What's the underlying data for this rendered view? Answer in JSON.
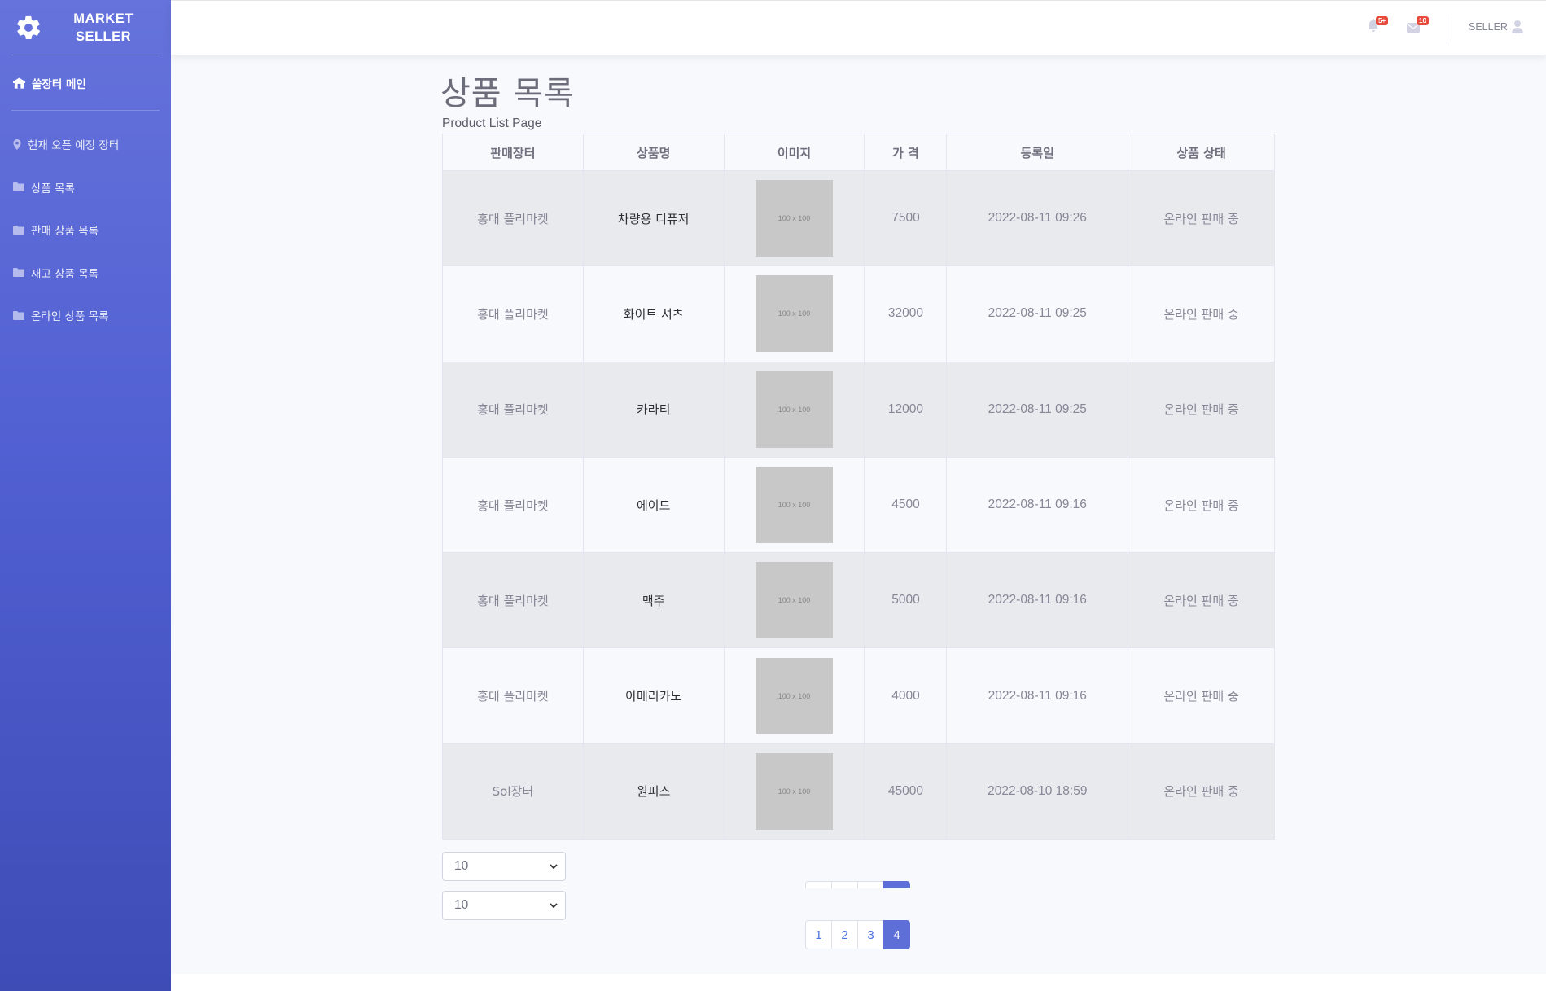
{
  "sidebar": {
    "brand": "MARKET SELLER",
    "brand_line1": "MARKET",
    "brand_line2": "SELLER",
    "main_item": "쏠장터 메인",
    "items": [
      {
        "label": "현재 오픈 예정 장터",
        "icon": "map-marker-icon"
      },
      {
        "label": "상품 목록",
        "icon": "folder-icon"
      },
      {
        "label": "판매 상품 목록",
        "icon": "folder-icon"
      },
      {
        "label": "재고 상품 목록",
        "icon": "folder-icon"
      },
      {
        "label": "온라인 상품 목록",
        "icon": "folder-icon"
      }
    ]
  },
  "topbar": {
    "alerts_badge": "5+",
    "messages_badge": "10",
    "user_name": "SELLER"
  },
  "page": {
    "title": "상품 목록",
    "subtitle": "Product List Page"
  },
  "table": {
    "headers": [
      "판매장터",
      "상품명",
      "이미지",
      "가 격",
      "등록일",
      "상품 상태"
    ],
    "rows": [
      {
        "market": "홍대 플리마켓",
        "name": "차량용 디퓨저",
        "image": "100 x 100",
        "price": "7500",
        "date": "2022-08-11 09:26",
        "status": "온라인 판매 중"
      },
      {
        "market": "홍대 플리마켓",
        "name": "화이트 셔츠",
        "image": "100 x 100",
        "price": "32000",
        "date": "2022-08-11 09:25",
        "status": "온라인 판매 중"
      },
      {
        "market": "홍대 플리마켓",
        "name": "카라티",
        "image": "100 x 100",
        "price": "12000",
        "date": "2022-08-11 09:25",
        "status": "온라인 판매 중"
      },
      {
        "market": "홍대 플리마켓",
        "name": "에이드",
        "image": "100 x 100",
        "price": "4500",
        "date": "2022-08-11 09:16",
        "status": "온라인 판매 중"
      },
      {
        "market": "홍대 플리마켓",
        "name": "맥주",
        "image": "100 x 100",
        "price": "5000",
        "date": "2022-08-11 09:16",
        "status": "온라인 판매 중"
      },
      {
        "market": "홍대 플리마켓",
        "name": "아메리카노",
        "image": "100 x 100",
        "price": "4000",
        "date": "2022-08-11 09:16",
        "status": "온라인 판매 중"
      },
      {
        "market": "Sol장터",
        "name": "원피스",
        "image": "100 x 100",
        "price": "45000",
        "date": "2022-08-10 18:59",
        "status": "온라인 판매 중"
      }
    ]
  },
  "page_size_selects": [
    "10",
    "10"
  ],
  "pagination": {
    "pages": [
      "1",
      "2",
      "3",
      "4"
    ],
    "active": "4"
  },
  "colors": {
    "sidebar_top": "#6673dc",
    "sidebar_bottom": "#3e4cb6",
    "active_page": "#5f6fd8",
    "badge": "#e74a3b"
  }
}
